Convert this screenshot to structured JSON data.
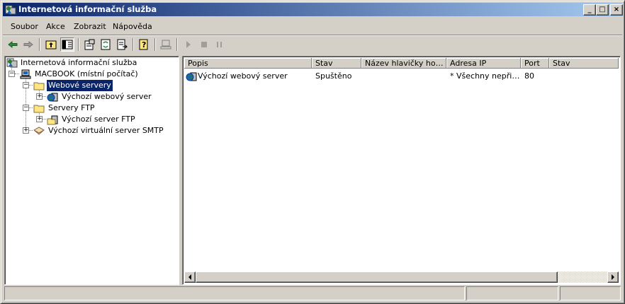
{
  "window": {
    "title": "Internetová informační služba",
    "buttons": {
      "minimize": "_",
      "maximize": "□",
      "close": "×"
    }
  },
  "menu": [
    "Soubor",
    "Akce",
    "Zobrazit",
    "Nápověda"
  ],
  "toolbar": {
    "icons": [
      "back-icon",
      "forward-icon",
      "up-level-icon",
      "show-hide-tree-icon",
      "properties-icon",
      "refresh-icon",
      "export-list-icon",
      "help-icon",
      "computer-icon",
      "play-icon",
      "stop-icon",
      "pause-icon"
    ]
  },
  "tree": {
    "root": "Internetová informační služba",
    "computer": "MACBOOK (místní počítač)",
    "web_servers": "Webové servery",
    "default_web": "Výchozí webový server",
    "ftp_servers": "Servery FTP",
    "default_ftp": "Výchozí server FTP",
    "smtp": "Výchozí virtuální server SMTP",
    "expander_minus": "−",
    "expander_plus": "+"
  },
  "list": {
    "columns": [
      "Popis",
      "Stav",
      "Název hlavičky host…",
      "Adresa IP",
      "Port",
      "Stav"
    ],
    "rows": [
      {
        "popis": "Výchozí webový server",
        "stav": "Spuštěno",
        "host": "",
        "ip": "* Všechny nepřiř…",
        "port": "80",
        "stav2": ""
      }
    ]
  },
  "colors": {
    "title_start": "#0a246a",
    "title_end": "#a6caf0",
    "selection": "#0a246a",
    "face": "#d4d0c8"
  }
}
